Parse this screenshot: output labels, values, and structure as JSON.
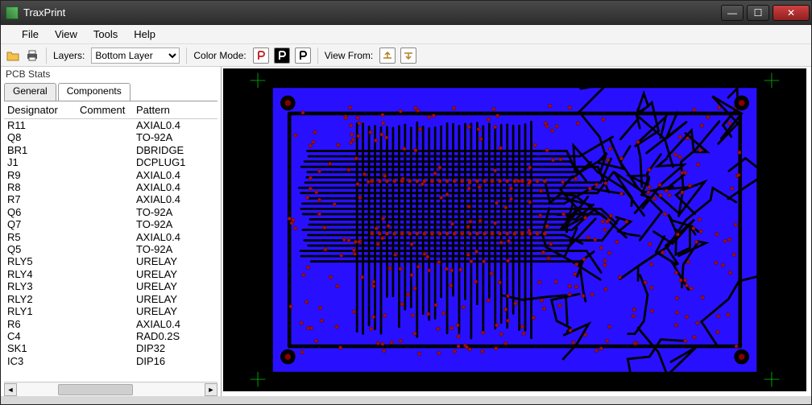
{
  "window": {
    "title": "TraxPrint"
  },
  "menu": {
    "file": "File",
    "view": "View",
    "tools": "Tools",
    "help": "Help"
  },
  "toolbar": {
    "layers_label": "Layers:",
    "layers_value": "Bottom Layer",
    "colormode_label": "Color Mode:",
    "viewfrom_label": "View From:"
  },
  "sidebar": {
    "panel_title": "PCB Stats",
    "tabs": {
      "general": "General",
      "components": "Components"
    },
    "columns": {
      "designator": "Designator",
      "comment": "Comment",
      "pattern": "Pattern"
    },
    "rows": [
      {
        "designator": "R11",
        "comment": "",
        "pattern": "AXIAL0.4"
      },
      {
        "designator": "Q8",
        "comment": "",
        "pattern": "TO-92A"
      },
      {
        "designator": "BR1",
        "comment": "",
        "pattern": "DBRIDGE"
      },
      {
        "designator": "J1",
        "comment": "",
        "pattern": "DCPLUG1"
      },
      {
        "designator": "R9",
        "comment": "",
        "pattern": "AXIAL0.4"
      },
      {
        "designator": "R8",
        "comment": "",
        "pattern": "AXIAL0.4"
      },
      {
        "designator": "R7",
        "comment": "",
        "pattern": "AXIAL0.4"
      },
      {
        "designator": "Q6",
        "comment": "",
        "pattern": "TO-92A"
      },
      {
        "designator": "Q7",
        "comment": "",
        "pattern": "TO-92A"
      },
      {
        "designator": "R5",
        "comment": "",
        "pattern": "AXIAL0.4"
      },
      {
        "designator": "Q5",
        "comment": "",
        "pattern": "TO-92A"
      },
      {
        "designator": "RLY5",
        "comment": "",
        "pattern": "URELAY"
      },
      {
        "designator": "RLY4",
        "comment": "",
        "pattern": "URELAY"
      },
      {
        "designator": "RLY3",
        "comment": "",
        "pattern": "URELAY"
      },
      {
        "designator": "RLY2",
        "comment": "",
        "pattern": "URELAY"
      },
      {
        "designator": "RLY1",
        "comment": "",
        "pattern": "URELAY"
      },
      {
        "designator": "R6",
        "comment": "",
        "pattern": "AXIAL0.4"
      },
      {
        "designator": "C4",
        "comment": "",
        "pattern": "RAD0.2S"
      },
      {
        "designator": "SK1",
        "comment": "",
        "pattern": "DIP32"
      },
      {
        "designator": "IC3",
        "comment": "",
        "pattern": "DIP16"
      }
    ]
  }
}
